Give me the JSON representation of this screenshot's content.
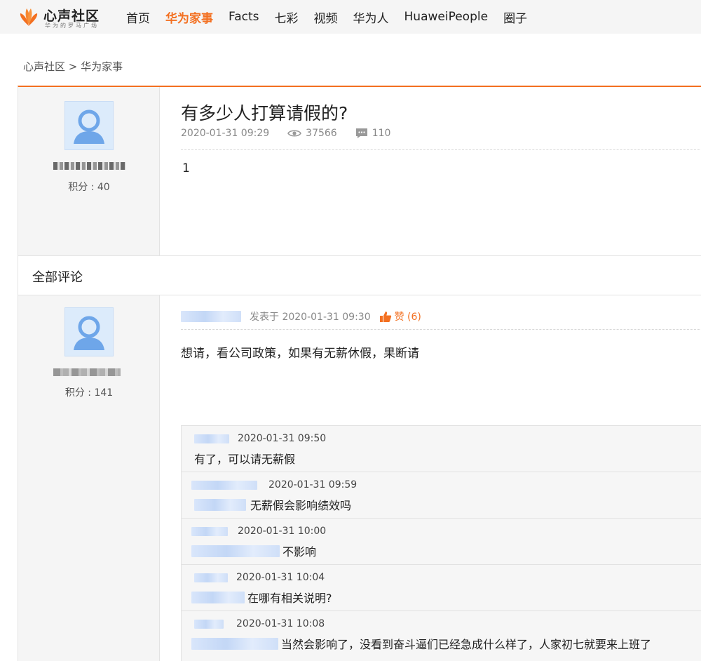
{
  "brand": {
    "title": "心声社区",
    "subtitle": "华为的罗马广场",
    "accent_color": "#f37021"
  },
  "nav": {
    "items": [
      "首页",
      "华为家事",
      "Facts",
      "七彩",
      "视频",
      "华为人",
      "HuaweiPeople",
      "圈子"
    ],
    "active": "华为家事"
  },
  "breadcrumb": "心声社区 > 华为家事",
  "post": {
    "author_score": "积分 : 40",
    "title": "有多少人打算请假的?",
    "date": "2020-01-31 09:29",
    "views": "37566",
    "comments": "110",
    "content": "1"
  },
  "comments_section": {
    "title": "全部评论"
  },
  "reply": {
    "author_score": "积分 : 141",
    "posted_prefix": "发表于 2020-01-31 09:30",
    "like_label": "赞 (6)",
    "content": "想请，看公司政策，如果有无薪休假，果断请",
    "subcomments": [
      {
        "time": "2020-01-31 09:50",
        "text": "有了，可以请无薪假"
      },
      {
        "time": "2020-01-31 09:59",
        "text": "无薪假会影响绩效吗"
      },
      {
        "time": "2020-01-31 10:00",
        "text": "不影响"
      },
      {
        "time": "2020-01-31 10:04",
        "text": "在哪有相关说明?"
      },
      {
        "time": "2020-01-31 10:08",
        "text": "当然会影响了，没看到奋斗逼们已经急成什么样了，人家初七就要来上班了"
      }
    ]
  }
}
